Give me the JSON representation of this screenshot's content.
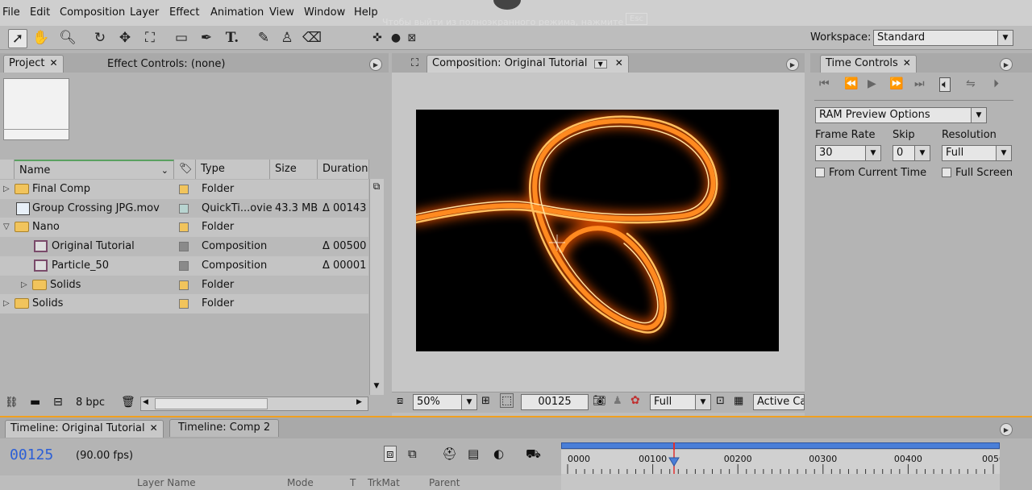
{
  "menu": [
    "File",
    "Edit",
    "Composition",
    "Layer",
    "Effect",
    "Animation",
    "View",
    "Window",
    "Help"
  ],
  "overlay_hint": "Чтобы выйти из полноэкранного режима, нажмите",
  "overlay_key": "Esc",
  "workspace": {
    "label": "Workspace:",
    "value": "Standard"
  },
  "project_panel": {
    "tab_project": "Project",
    "tab_effect": "Effect Controls: (none)",
    "columns": [
      "Name",
      "Type",
      "Size",
      "Duration"
    ],
    "items": [
      {
        "name": "Final Comp",
        "type": "Folder",
        "size": "",
        "duration": "",
        "icon": "folder",
        "level": 0,
        "expand": "▷"
      },
      {
        "name": "Group Crossing JPG.mov",
        "type": "QuickTi...ovie",
        "size": "43.3 MB",
        "duration": "Δ 00143",
        "icon": "movie",
        "level": 0,
        "expand": ""
      },
      {
        "name": "Nano",
        "type": "Folder",
        "size": "",
        "duration": "",
        "icon": "folder",
        "level": 0,
        "expand": "▽"
      },
      {
        "name": "Original Tutorial",
        "type": "Composition",
        "size": "",
        "duration": "Δ 00500",
        "icon": "comp",
        "level": 1,
        "expand": ""
      },
      {
        "name": "Particle_50",
        "type": "Composition",
        "size": "",
        "duration": "Δ 00001",
        "icon": "comp",
        "level": 1,
        "expand": ""
      },
      {
        "name": "Solids",
        "type": "Folder",
        "size": "",
        "duration": "",
        "icon": "folder",
        "level": 1,
        "expand": "▷"
      },
      {
        "name": "Solids",
        "type": "Folder",
        "size": "",
        "duration": "",
        "icon": "folder",
        "level": 0,
        "expand": "▷"
      }
    ],
    "bpc": "8 bpc"
  },
  "composition_panel": {
    "tab": "Composition: Original Tutorial",
    "zoom": "50%",
    "timecode": "00125",
    "resolution": "Full",
    "camera": "Active Ca"
  },
  "time_controls": {
    "tab": "Time Controls",
    "ram_preview": "RAM Preview Options",
    "frame_rate_label": "Frame Rate",
    "skip_label": "Skip",
    "resolution_label": "Resolution",
    "frame_rate": "30",
    "skip": "0",
    "resolution": "Full",
    "from_current_time": "From Current Time",
    "full_screen": "Full Screen"
  },
  "timeline": {
    "tab1": "Timeline: Original Tutorial",
    "tab2": "Timeline: Comp 2",
    "timecode": "00125",
    "fps": "(90.00 fps)",
    "ruler": [
      "0000",
      "00100",
      "00200",
      "00300",
      "00400",
      "0050"
    ],
    "columns": [
      "Layer Name",
      "Mode",
      "T",
      "TrkMat",
      "Parent"
    ],
    "playhead_frame": 125,
    "ruler_max": 500
  },
  "colors": {
    "accent_orange": "#f0a020",
    "timecode_blue": "#2c5fd6",
    "playhead_red": "#e03030"
  }
}
